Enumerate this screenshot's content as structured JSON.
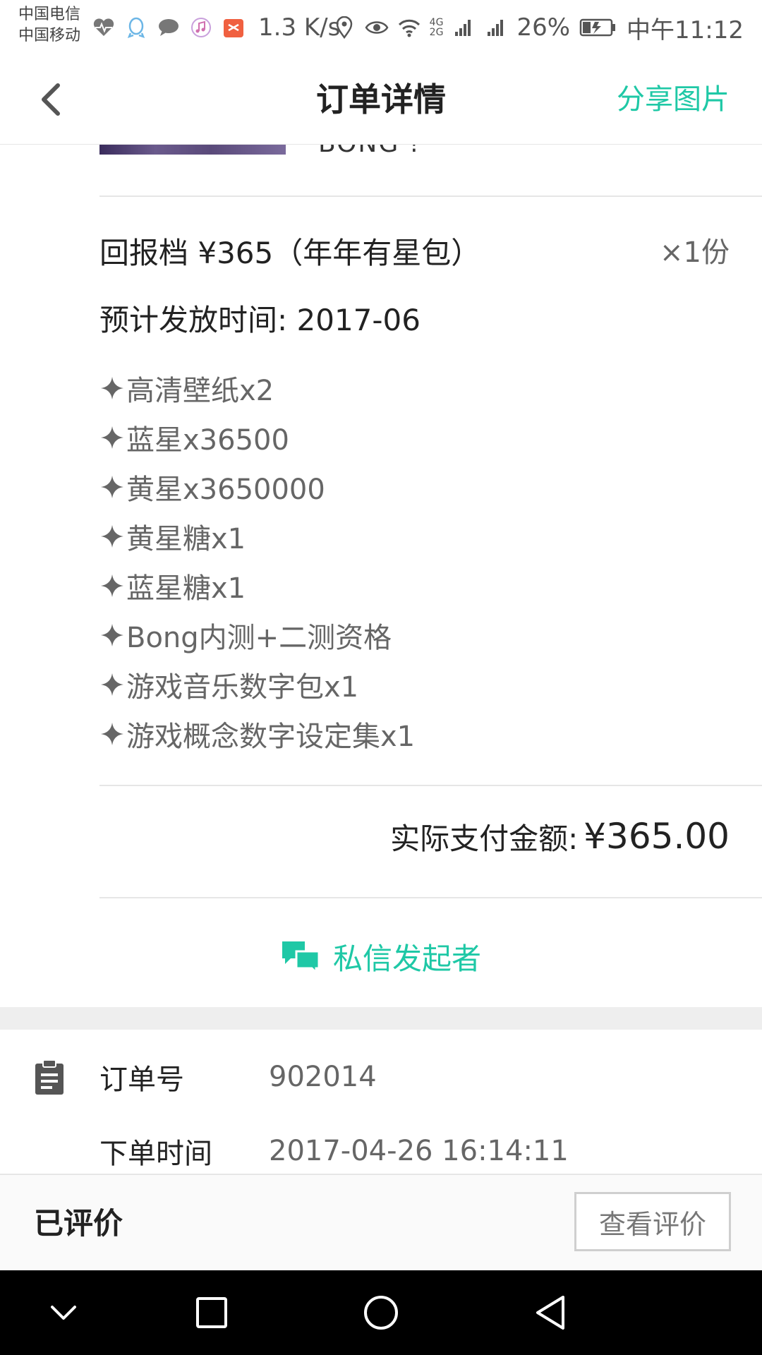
{
  "status_bar": {
    "carrier_1": "中国电信",
    "carrier_2": "中国移动",
    "speed": "1.3 K/s",
    "net_label_1": "4G",
    "net_label_2": "2G",
    "battery": "26%",
    "time": "中午11:12"
  },
  "header": {
    "title": "订单详情",
    "share": "分享图片"
  },
  "product": {
    "name": "BONG !",
    "tier": "回报档  ¥365（年年有星包）",
    "quantity": "×1份",
    "delivery_label": "预计发放时间:",
    "delivery_date": "2017-06",
    "rewards": [
      "高清壁纸x2",
      "蓝星x36500",
      "黄星x3650000",
      "黄星糖x1",
      "蓝星糖x1",
      "Bong内测+二测资格",
      "游戏音乐数字包x1",
      "游戏概念数字设定集x1"
    ],
    "paid_label": "实际支付金额:",
    "paid_amount": "¥365.00"
  },
  "message_button": "私信发起者",
  "order_info": {
    "order_no_label": "订单号",
    "order_no": "902014",
    "order_time_label": "下单时间",
    "order_time": "2017-04-26 16:14:11"
  },
  "bottom_bar": {
    "status": "已评价",
    "view_review": "查看评价"
  },
  "colors": {
    "accent": "#1fc8a6",
    "text_dark": "#222222",
    "text_gray": "#666666",
    "divider": "#e6e6e6"
  }
}
